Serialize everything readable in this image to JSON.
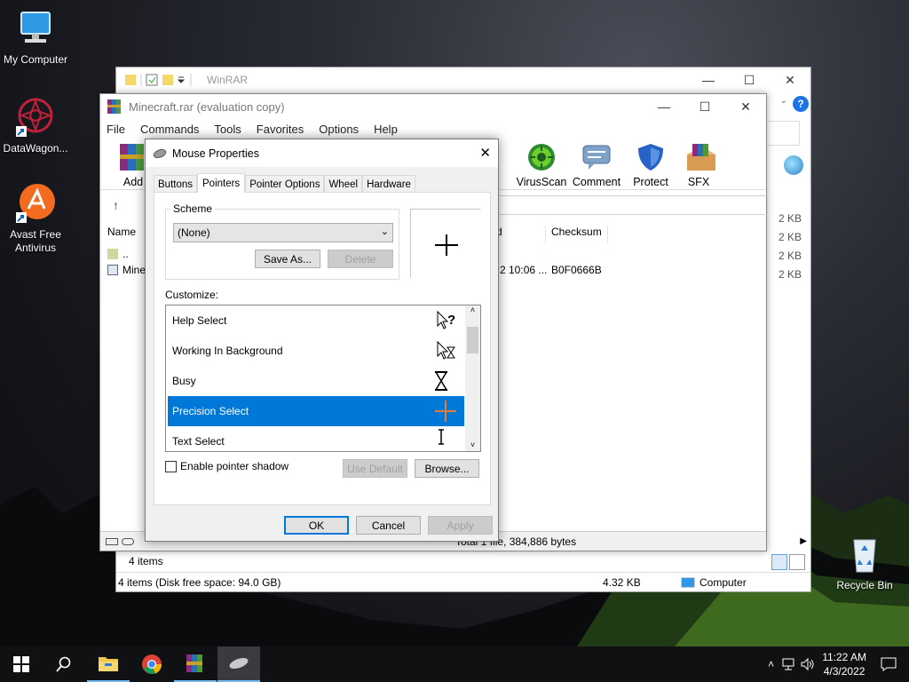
{
  "desktop": {
    "icons": [
      {
        "label": "My Computer"
      },
      {
        "label": "DataWagon..."
      },
      {
        "label": "Avast Free\nAntivirus"
      },
      {
        "label": "Recycle Bin"
      }
    ]
  },
  "explorer": {
    "title": "WinRAR",
    "status_items": "4 items (Disk free space: 94.0 GB)",
    "status_size": "4.32 KB",
    "status_location": "Computer",
    "items_count": "4 items",
    "sizes": [
      "2 KB",
      "2 KB",
      "2 KB",
      "2 KB"
    ]
  },
  "winrar": {
    "title": "Minecraft.rar (evaluation copy)",
    "menu": [
      "File",
      "Commands",
      "Tools",
      "Favorites",
      "Options",
      "Help"
    ],
    "toolbar": {
      "add": "Add",
      "virusscan": "VirusScan",
      "comment": "Comment",
      "protect": "Protect",
      "sfx": "SFX"
    },
    "columns": {
      "name": "Name",
      "modified": "d",
      "checksum": "Checksum"
    },
    "rows": [
      {
        "name": "..",
        "modified": "",
        "checksum": ""
      },
      {
        "name": "Mine",
        "modified": "2 10:06 ...",
        "checksum": "B0F0666B"
      }
    ],
    "status": "Total 1 file, 384,886 bytes"
  },
  "dialog": {
    "title": "Mouse Properties",
    "tabs": [
      "Buttons",
      "Pointers",
      "Pointer Options",
      "Wheel",
      "Hardware"
    ],
    "active_tab": "Pointers",
    "scheme_label": "Scheme",
    "scheme_value": "(None)",
    "save_as": "Save As...",
    "delete": "Delete",
    "customize_label": "Customize:",
    "pointer_list": [
      {
        "label": "Help Select",
        "icon": "help-select-cursor"
      },
      {
        "label": "Working In Background",
        "icon": "working-background-cursor"
      },
      {
        "label": "Busy",
        "icon": "busy-hourglass-cursor"
      },
      {
        "label": "Precision Select",
        "icon": "precision-crosshair-cursor",
        "selected": true
      },
      {
        "label": "Text Select",
        "icon": "text-ibeam-cursor"
      }
    ],
    "shadow_label": "Enable pointer shadow",
    "shadow_checked": false,
    "use_default": "Use Default",
    "browse": "Browse...",
    "ok": "OK",
    "cancel": "Cancel",
    "apply": "Apply"
  },
  "taskbar": {
    "time": "11:22 AM",
    "date": "4/3/2022",
    "pinned": [
      "start-icon",
      "search-icon",
      "file-explorer-icon",
      "chrome-icon",
      "winrar-icon",
      "mouse-properties-icon"
    ]
  }
}
